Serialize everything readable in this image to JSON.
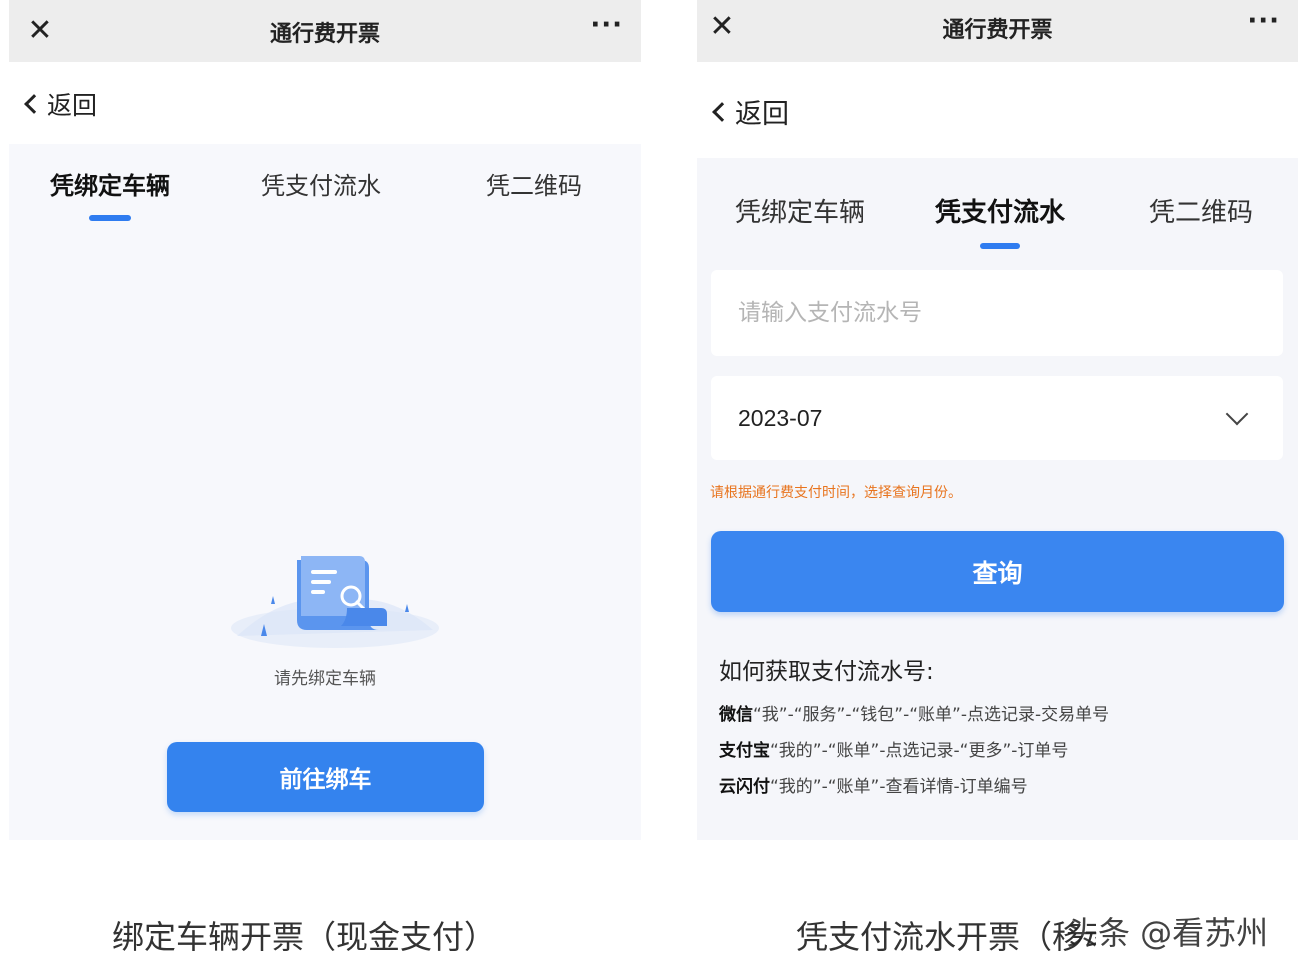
{
  "left_screen": {
    "window_title": "通行费开票",
    "close_icon_glyph": "✕",
    "more_icon_glyph": "···",
    "back_label": "返回",
    "tabs": [
      {
        "label": "凭绑定车辆",
        "active": true
      },
      {
        "label": "凭支付流水",
        "active": false
      },
      {
        "label": "凭二维码",
        "active": false
      }
    ],
    "empty_state": {
      "icon": "invoice-search-illustration",
      "message": "请先绑定车辆"
    },
    "bind_button_label": "前往绑车"
  },
  "right_screen": {
    "window_title": "通行费开票",
    "close_icon_glyph": "✕",
    "more_icon_glyph": "···",
    "back_label": "返回",
    "tabs": [
      {
        "label": "凭绑定车辆",
        "active": false
      },
      {
        "label": "凭支付流水",
        "active": true
      },
      {
        "label": "凭二维码",
        "active": false
      }
    ],
    "pay_input": {
      "value": "",
      "placeholder": "请输入支付流水号"
    },
    "month_select": {
      "value": "2023-07"
    },
    "hint": "请根据通行费支付时间，选择查询月份。",
    "query_button_label": "查询",
    "howto": {
      "title": "如何获取支付流水号:",
      "rows": [
        {
          "app": "微信",
          "path": "“我”-“服务”-“钱包”-“账单”-点选记录-交易单号"
        },
        {
          "app": "支付宝",
          "path": "“我的”-“账单”-点选记录-“更多”-订单号"
        },
        {
          "app": "云闪付",
          "path": "“我的”-“账单”-查看详情-订单编号"
        }
      ]
    }
  },
  "captions": {
    "left": "绑定车辆开票（现金支付）",
    "right": "凭支付流水开票（移动支付）",
    "watermark": "头条 @看苏州"
  },
  "colors": {
    "accent": "#3483ee",
    "hint": "#e8741e",
    "titlebar": "#ededed"
  }
}
